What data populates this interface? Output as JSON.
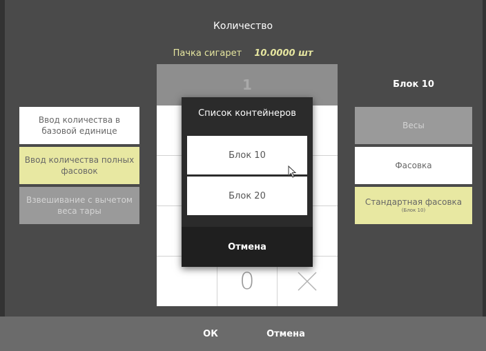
{
  "dialog": {
    "title": "Количество",
    "product_name": "Пачка сигарет",
    "product_quantity": "10.0000 шт"
  },
  "numpad": {
    "display_value": "1",
    "zero_key": "0",
    "clear_icon": "close-x-icon"
  },
  "left_modes": [
    {
      "label": "Ввод количества в базовой единице",
      "state": "normal"
    },
    {
      "label": "Ввод количества полных фасовок",
      "state": "selected"
    },
    {
      "label": "Взвешивание с вычетом веса тары",
      "state": "disabled"
    }
  ],
  "right_panel": {
    "title": "Блок 10",
    "buttons": [
      {
        "label": "Весы",
        "sub": "",
        "state": "disabled"
      },
      {
        "label": "Фасовка",
        "sub": "",
        "state": "normal"
      },
      {
        "label": "Стандартная фасовка",
        "sub": "(Блок 10)",
        "state": "selected"
      }
    ]
  },
  "popup": {
    "title": "Список контейнеров",
    "items": [
      "Блок 10",
      "Блок 20"
    ],
    "cancel_label": "Отмена"
  },
  "footer": {
    "ok_label": "ОК",
    "cancel_label": "Отмена"
  },
  "colors": {
    "background": "#4a4a4a",
    "selected_yellow": "#e8e8a2",
    "disabled_gray": "#9a9a9a",
    "popup_dark": "#2b2b2b",
    "accent_text": "#e6e6a0"
  }
}
